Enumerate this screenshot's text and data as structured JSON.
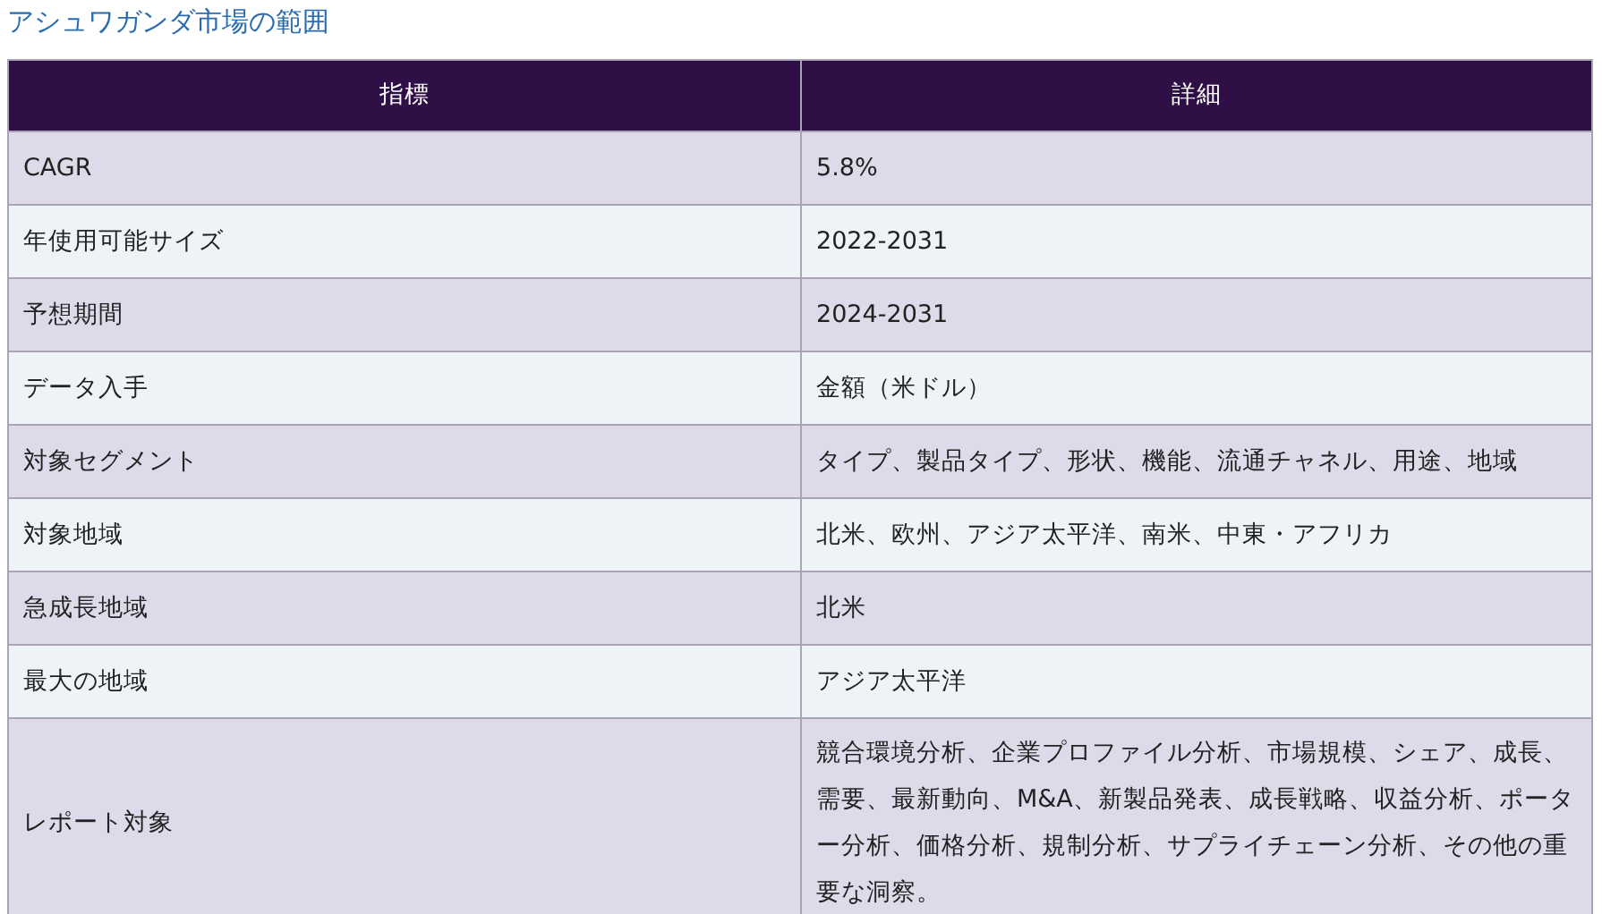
{
  "title": "アシュワガンダ市場の範囲",
  "table": {
    "columns": [
      "指標",
      "詳細"
    ],
    "rows": [
      {
        "label": "CAGR",
        "value": "5.8%"
      },
      {
        "label": "年使用可能サイズ",
        "value": "2022-2031"
      },
      {
        "label": "予想期間",
        "value": "2024-2031"
      },
      {
        "label": "データ入手",
        "value": "金額（米ドル）"
      },
      {
        "label": "対象セグメント",
        "value": "タイプ、製品タイプ、形状、機能、流通チャネル、用途、地域"
      },
      {
        "label": "対象地域",
        "value": "北米、欧州、アジア太平洋、南米、中東・アフリカ"
      },
      {
        "label": "急成長地域",
        "value": "北米"
      },
      {
        "label": "最大の地域",
        "value": "アジア太平洋"
      },
      {
        "label": "レポート対象",
        "value": "競合環境分析、企業プロファイル分析、市場規模、シェア、成長、需要、最新動向、M&A、新製品発表、成長戦略、収益分析、ポーター分析、価格分析、規制分析、サプライチェーン分析、その他の重要な洞察。"
      }
    ]
  }
}
